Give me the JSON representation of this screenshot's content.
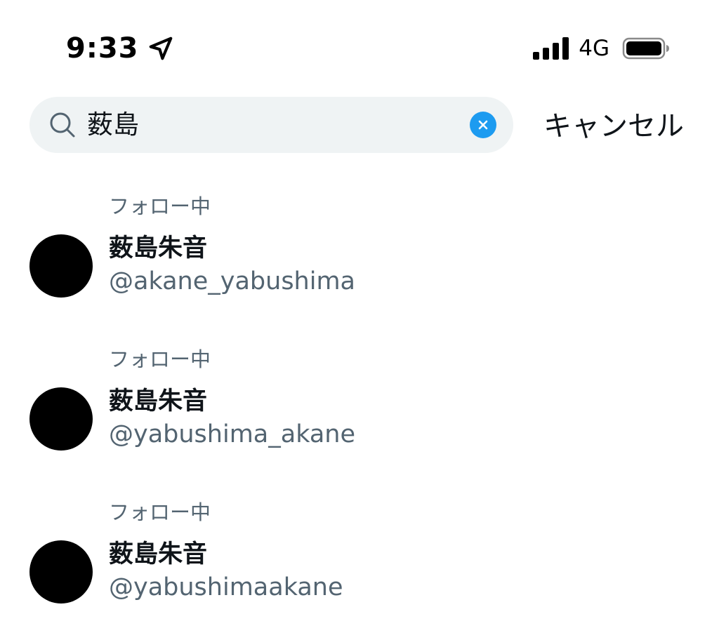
{
  "status_bar": {
    "time": "9:33",
    "location_icon": "location-arrow-icon",
    "network": "4G",
    "signal_icon": "cellular-signal-icon",
    "battery_icon": "battery-icon"
  },
  "search": {
    "icon": "search-icon",
    "value": "薮島",
    "clear_icon": "clear-icon",
    "cancel_label": "キャンセル"
  },
  "results": [
    {
      "follow_label": "フォロー中",
      "name": "薮島朱音",
      "handle": "@akane_yabushima"
    },
    {
      "follow_label": "フォロー中",
      "name": "薮島朱音",
      "handle": "@yabushima_akane"
    },
    {
      "follow_label": "フォロー中",
      "name": "薮島朱音",
      "handle": "@yabushimaakane"
    }
  ],
  "colors": {
    "accent": "#1d9bf0",
    "search_bg": "#eff3f4",
    "secondary_text": "#536471",
    "primary_text": "#0f1419"
  }
}
